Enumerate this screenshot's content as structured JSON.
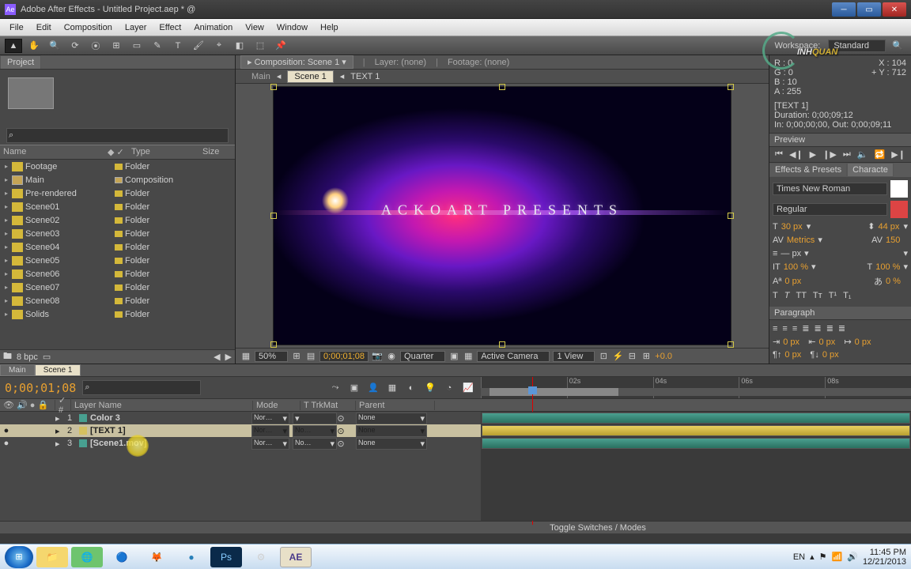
{
  "title": "Adobe After Effects - Untitled Project.aep * @",
  "menus": [
    "File",
    "Edit",
    "Composition",
    "Layer",
    "Effect",
    "Animation",
    "View",
    "Window",
    "Help"
  ],
  "workspace": {
    "label": "Workspace:",
    "value": "Standard"
  },
  "project": {
    "tab": "Project",
    "search_placeholder": "",
    "cols": {
      "name": "Name",
      "type": "Type",
      "size": "Size"
    },
    "items": [
      {
        "name": "Footage",
        "type": "Folder",
        "icon": "folder"
      },
      {
        "name": "Main",
        "type": "Composition",
        "icon": "comp"
      },
      {
        "name": "Pre-rendered",
        "type": "Folder",
        "icon": "folder"
      },
      {
        "name": "Scene01",
        "type": "Folder",
        "icon": "folder"
      },
      {
        "name": "Scene02",
        "type": "Folder",
        "icon": "folder"
      },
      {
        "name": "Scene03",
        "type": "Folder",
        "icon": "folder"
      },
      {
        "name": "Scene04",
        "type": "Folder",
        "icon": "folder"
      },
      {
        "name": "Scene05",
        "type": "Folder",
        "icon": "folder"
      },
      {
        "name": "Scene06",
        "type": "Folder",
        "icon": "folder"
      },
      {
        "name": "Scene07",
        "type": "Folder",
        "icon": "folder"
      },
      {
        "name": "Scene08",
        "type": "Folder",
        "icon": "folder"
      },
      {
        "name": "Solids",
        "type": "Folder",
        "icon": "folder"
      }
    ],
    "bpc": "8 bpc"
  },
  "composition": {
    "tab_prefix": "Composition:",
    "tab_value": "Scene 1",
    "other_tabs": [
      "Layer: (none)",
      "Footage: (none)"
    ],
    "crumbs": {
      "root": "Main",
      "current": "Scene 1",
      "child": "TEXT 1"
    },
    "preview_text": "ACKOART PRESENTS",
    "footer": {
      "zoom": "50%",
      "timecode": "0;00;01;08",
      "res": "Quarter",
      "camera": "Active Camera",
      "views": "1 View",
      "exposure": "+0.0"
    }
  },
  "info": {
    "rgba": {
      "r": "R : 0",
      "g": "G : 0",
      "b": "B : 10",
      "a": "A : 255"
    },
    "xy": {
      "x": "X : 104",
      "y": "Y : 712"
    },
    "layer": "[TEXT 1]",
    "duration": "Duration: 0;00;09;12",
    "inout": "In: 0;00;00;00, Out: 0;00;09;11"
  },
  "preview_tab": "Preview",
  "effects_tab": "Effects & Presets",
  "character_tab": "Characte",
  "character": {
    "font": "Times New Roman",
    "style": "Regular",
    "size": "30 px",
    "leading": "44 px",
    "kerning": "Metrics",
    "tracking": "150",
    "vscale": "100 %",
    "hscale": "100 %",
    "baseline": "0 px",
    "tsume": "0 %",
    "unit_px": "px"
  },
  "paragraph_tab": "Paragraph",
  "paragraph": {
    "left": "0 px",
    "right": "0 px",
    "first": "0 px",
    "before": "0 px",
    "after": "0 px"
  },
  "timeline": {
    "tabs": [
      "Main",
      "Scene 1"
    ],
    "timecode": "0;00;01;08",
    "ruler": [
      "",
      "02s",
      "04s",
      "06s",
      "08s"
    ],
    "cols": {
      "layer_name": "Layer Name",
      "mode": "Mode",
      "trkmat": "TrkMat",
      "parent": "Parent",
      "idx": "#"
    },
    "layers": [
      {
        "idx": "1",
        "name": "Color 3",
        "swatch": "#48a090",
        "mode": "Nor…",
        "trk": "",
        "parent": "None",
        "eye": ""
      },
      {
        "idx": "2",
        "name": "[TEXT 1]",
        "swatch": "#d4c060",
        "mode": "Nor…",
        "trk": "No…",
        "parent": "None",
        "eye": "●",
        "selected": true
      },
      {
        "idx": "3",
        "name": "[Scene1.mov]",
        "swatch": "#48a090",
        "mode": "Nor…",
        "trk": "No…",
        "parent": "None",
        "eye": "●"
      }
    ],
    "toggle_label": "Toggle Switches / Modes"
  },
  "taskbar": {
    "lang": "EN",
    "time": "11:45 PM",
    "date": "12/21/2013"
  },
  "watermark": {
    "pre": "INH",
    "accent": "QUAN"
  }
}
